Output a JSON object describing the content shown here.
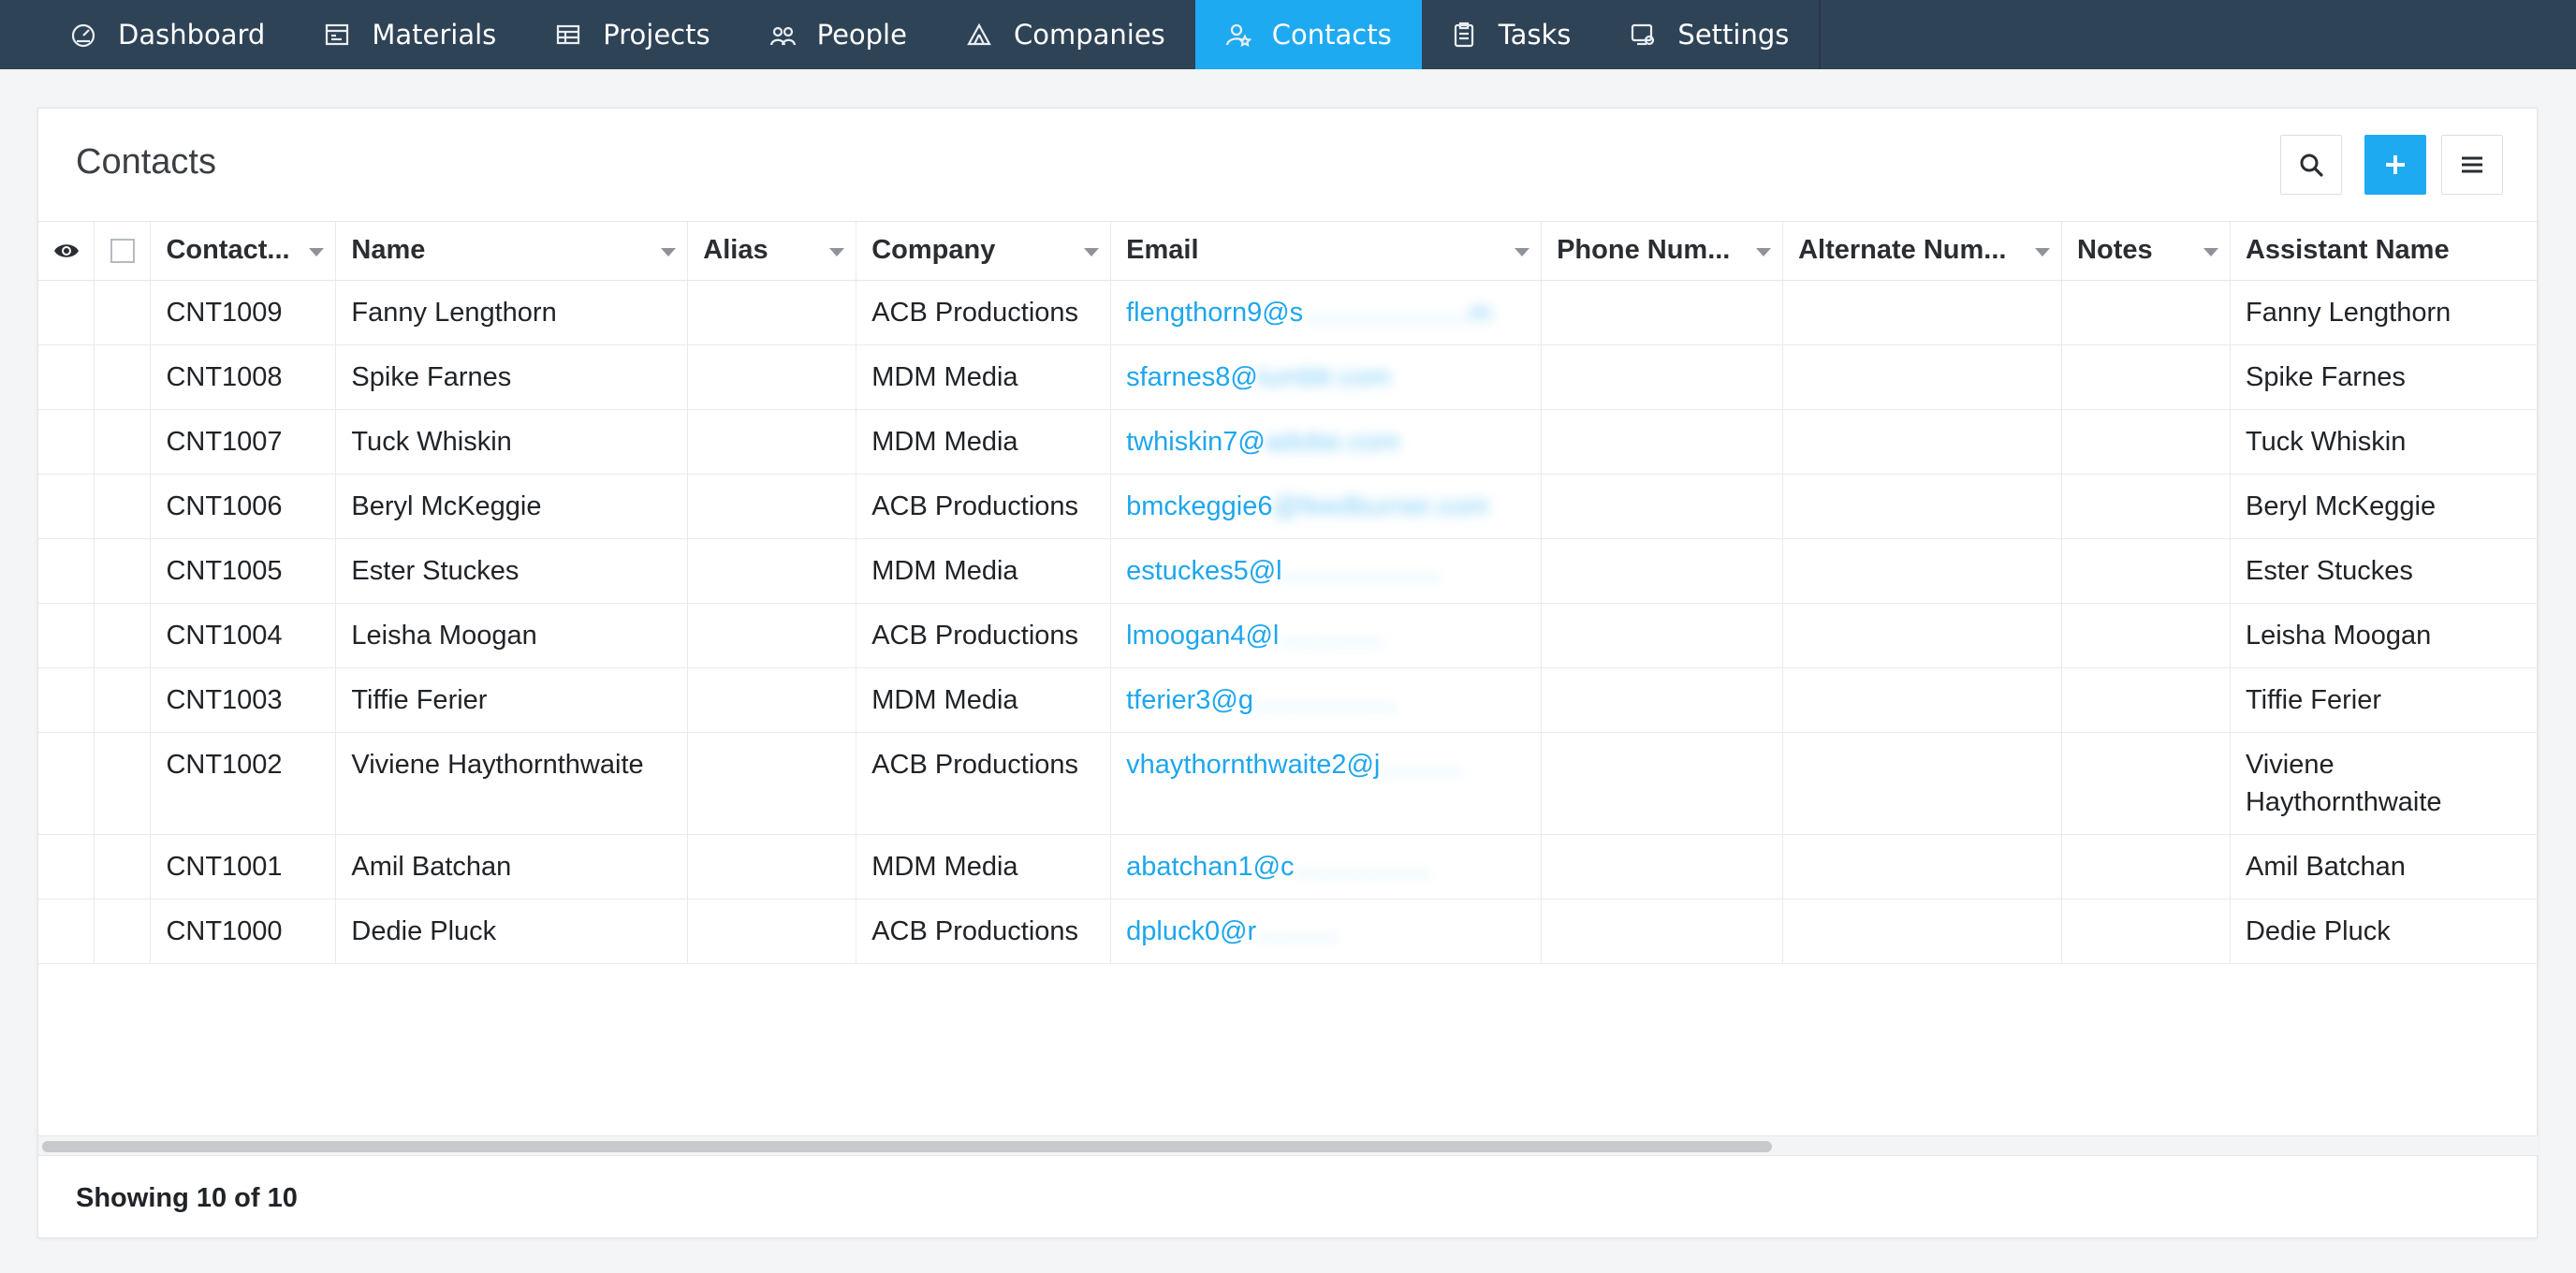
{
  "nav": {
    "items": [
      {
        "label": "Dashboard",
        "icon": "dashboard-icon"
      },
      {
        "label": "Materials",
        "icon": "materials-icon"
      },
      {
        "label": "Projects",
        "icon": "projects-icon"
      },
      {
        "label": "People",
        "icon": "people-icon"
      },
      {
        "label": "Companies",
        "icon": "companies-icon"
      },
      {
        "label": "Contacts",
        "icon": "contacts-icon",
        "active": true
      },
      {
        "label": "Tasks",
        "icon": "tasks-icon"
      },
      {
        "label": "Settings",
        "icon": "settings-icon"
      }
    ],
    "active_color": "#1eaaf1",
    "bar_color": "#2f4357"
  },
  "card": {
    "title": "Contacts",
    "search_icon": "search-icon",
    "add_icon": "plus-icon",
    "menu_icon": "hamburger-menu-icon"
  },
  "table": {
    "columns": [
      "Contact...",
      "Name",
      "Alias",
      "Company",
      "Email",
      "Phone Num...",
      "Alternate Num...",
      "Notes",
      "Assistant Name"
    ],
    "rows": [
      {
        "id": "CNT1009",
        "name": "Fanny Lengthorn",
        "alias": "",
        "company": "ACB Productions",
        "email_visible": "flengthorn9@s",
        "email_blurred": "......................m",
        "phone": "",
        "alt": "",
        "notes": "",
        "assistant": "Fanny Lengthorn"
      },
      {
        "id": "CNT1008",
        "name": "Spike Farnes",
        "alias": "",
        "company": "MDM Media",
        "email_visible": "sfarnes8@",
        "email_blurred": "tumblr.com",
        "phone": "",
        "alt": "",
        "notes": "",
        "assistant": "Spike Farnes"
      },
      {
        "id": "CNT1007",
        "name": "Tuck Whiskin",
        "alias": "",
        "company": "MDM Media",
        "email_visible": "twhiskin7@",
        "email_blurred": "adobe.com",
        "phone": "",
        "alt": "",
        "notes": "",
        "assistant": "Tuck Whiskin"
      },
      {
        "id": "CNT1006",
        "name": "Beryl McKeggie",
        "alias": "",
        "company": "ACB Productions",
        "email_visible": "bmckeggie6",
        "email_blurred": "@feedburner.com",
        "phone": "",
        "alt": "",
        "notes": "",
        "assistant": "Beryl McKeggie"
      },
      {
        "id": "CNT1005",
        "name": "Ester Stuckes",
        "alias": "",
        "company": "MDM Media",
        "email_visible": "estuckes5@l",
        "email_blurred": ".....................",
        "phone": "",
        "alt": "",
        "notes": "",
        "assistant": "Ester Stuckes"
      },
      {
        "id": "CNT1004",
        "name": "Leisha Moogan",
        "alias": "",
        "company": "ACB Productions",
        "email_visible": "lmoogan4@l",
        "email_blurred": "..............",
        "phone": "",
        "alt": "",
        "notes": "",
        "assistant": "Leisha Moogan"
      },
      {
        "id": "CNT1003",
        "name": "Tiffie Ferier",
        "alias": "",
        "company": "MDM Media",
        "email_visible": "tferier3@g",
        "email_blurred": "...................",
        "phone": "",
        "alt": "",
        "notes": "",
        "assistant": "Tiffie Ferier"
      },
      {
        "id": "CNT1002",
        "name": "Viviene Haythornthwaite",
        "alias": "",
        "company": "ACB Productions",
        "email_visible": "vhaythornthwaite2@j",
        "email_blurred": "...........",
        "phone": "",
        "alt": "",
        "notes": "",
        "assistant": "Viviene Haythornthwaite",
        "tall": true
      },
      {
        "id": "CNT1001",
        "name": "Amil Batchan",
        "alias": "",
        "company": "MDM Media",
        "email_visible": "abatchan1@c",
        "email_blurred": "..................",
        "phone": "",
        "alt": "",
        "notes": "",
        "assistant": "Amil Batchan"
      },
      {
        "id": "CNT1000",
        "name": "Dedie Pluck",
        "alias": "",
        "company": "ACB Productions",
        "email_visible": "dpluck0@r",
        "email_blurred": "...........",
        "phone": "",
        "alt": "",
        "notes": "",
        "assistant": "Dedie Pluck"
      }
    ]
  },
  "footer": {
    "status": "Showing 10 of 10"
  }
}
